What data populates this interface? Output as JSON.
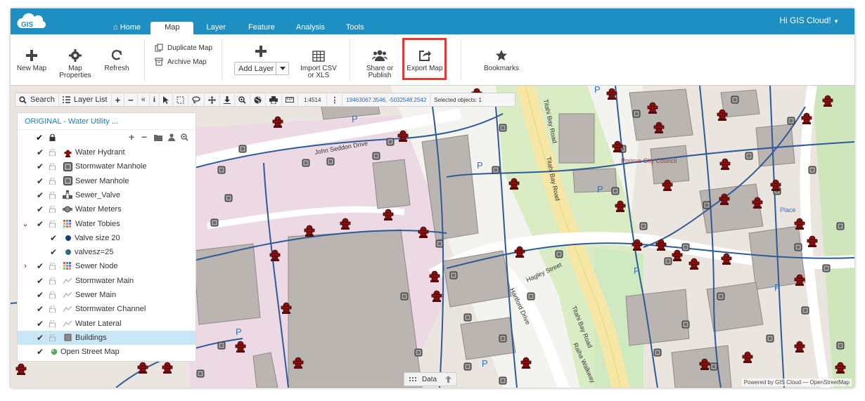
{
  "app": {
    "logo_text": "GIS",
    "greeting": "Hi GIS Cloud!"
  },
  "nav": {
    "tabs": [
      {
        "label": "Home",
        "icon": "home-icon"
      },
      {
        "label": "Map"
      },
      {
        "label": "Layer"
      },
      {
        "label": "Feature"
      },
      {
        "label": "Analysis"
      },
      {
        "label": "Tools"
      }
    ],
    "active": "Map"
  },
  "ribbon": {
    "new_map": "New Map",
    "map_properties": "Map\nProperties",
    "refresh": "Refresh",
    "duplicate_map": "Duplicate Map",
    "archive_map": "Archive Map",
    "add_layer": "Add Layer",
    "import_csv": "Import CSV\nor XLS",
    "share_publish": "Share or\nPublish",
    "export_map": "Export Map",
    "bookmarks": "Bookmarks"
  },
  "map_toolbar": {
    "search": "Search",
    "layer_list": "Layer List",
    "scale": "1:4514",
    "coordinates": "19463067.3546, -5032548.2542",
    "selected_objects": "Selected objects: 1"
  },
  "layer_panel": {
    "title": "ORIGINAL - Water Utility ...",
    "layers": [
      {
        "name": "Water Hydrant",
        "icon": "hydrant-icon"
      },
      {
        "name": "Stormwater Manhole",
        "icon": "manhole-icon"
      },
      {
        "name": "Sewer Manhole",
        "icon": "manhole-icon"
      },
      {
        "name": "Sewer_Valve",
        "icon": "valve-icon"
      },
      {
        "name": "Water Meters",
        "icon": "meter-icon"
      },
      {
        "name": "Water Tobies",
        "icon": "grid-icon"
      },
      {
        "name": "Valve size 20",
        "icon": "dot-icon"
      },
      {
        "name": "valvesz=25",
        "icon": "dot-icon"
      },
      {
        "name": "Sewer Node",
        "icon": "grid-icon"
      },
      {
        "name": "Stormwater Main",
        "icon": "line-icon"
      },
      {
        "name": "Sewer Main",
        "icon": "line-icon"
      },
      {
        "name": "Stormwater Channel",
        "icon": "line-icon"
      },
      {
        "name": "Water Lateral",
        "icon": "line-icon"
      },
      {
        "name": "Buildings",
        "icon": "polygon-icon"
      },
      {
        "name": "Open Street Map",
        "icon": "globe-icon"
      }
    ]
  },
  "map_labels": {
    "street_1": "John Seddon Drive",
    "street_2": "Titahi Bay Road",
    "street_3": "Hagley Street",
    "street_4": "Hartford Drive",
    "street_5": "Raiha Walkway",
    "council": "Porirua City Council",
    "parking": "P",
    "place": "Place"
  },
  "bottom_bar": {
    "data_tab": "Data"
  },
  "attribution": "Powered by GIS Cloud — OpenStreetMap",
  "colors": {
    "brand": "#1d8fc3",
    "highlight": "#e53935",
    "hydrant": "#8b1111",
    "pipe": "#2f5a98"
  }
}
